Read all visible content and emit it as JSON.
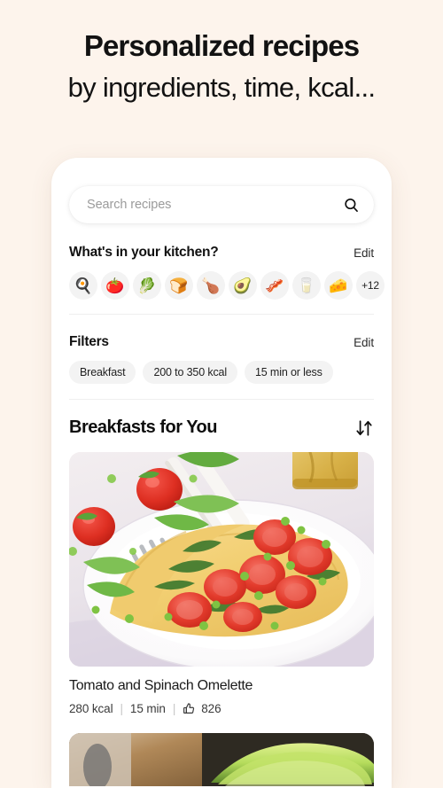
{
  "promo": {
    "line1": "Personalized recipes",
    "line2": "by ingredients, time, kcal..."
  },
  "colors": {
    "background": "#fdf4ec",
    "card": "#ffffff",
    "chip": "#f3f3f3",
    "text": "#121212",
    "muted": "#9b9b9b",
    "divider": "#efefef"
  },
  "search": {
    "placeholder": "Search recipes",
    "value": "",
    "icon": "search-icon"
  },
  "kitchen": {
    "title": "What's in your kitchen?",
    "edit_label": "Edit",
    "ingredients": [
      {
        "name": "egg",
        "emoji": "🍳"
      },
      {
        "name": "tomato",
        "emoji": "🍅"
      },
      {
        "name": "leafy-greens",
        "emoji": "🥬"
      },
      {
        "name": "bread",
        "emoji": "🍞"
      },
      {
        "name": "chicken-leg",
        "emoji": "🍗"
      },
      {
        "name": "avocado",
        "emoji": "🥑"
      },
      {
        "name": "bacon",
        "emoji": "🥓"
      },
      {
        "name": "milk",
        "emoji": "🥛"
      },
      {
        "name": "cheese",
        "emoji": "🧀"
      }
    ],
    "more_label": "+12"
  },
  "filters": {
    "title": "Filters",
    "edit_label": "Edit",
    "chips": [
      "Breakfast",
      "200 to 350 kcal",
      "15 min or less"
    ]
  },
  "feed": {
    "title": "Breakfasts for You",
    "sort_icon": "sort-arrows-icon",
    "recipes": [
      {
        "title": "Tomato and Spinach Omelette",
        "kcal": "280 kcal",
        "time": "15 min",
        "likes": "826",
        "separator": "|",
        "image_alt": "omelette-with-tomatoes-and-herbs"
      },
      {
        "title": "",
        "kcal": "",
        "time": "",
        "likes": "",
        "separator": "",
        "image_alt": "sliced-avocado-on-cutting-board"
      }
    ]
  }
}
